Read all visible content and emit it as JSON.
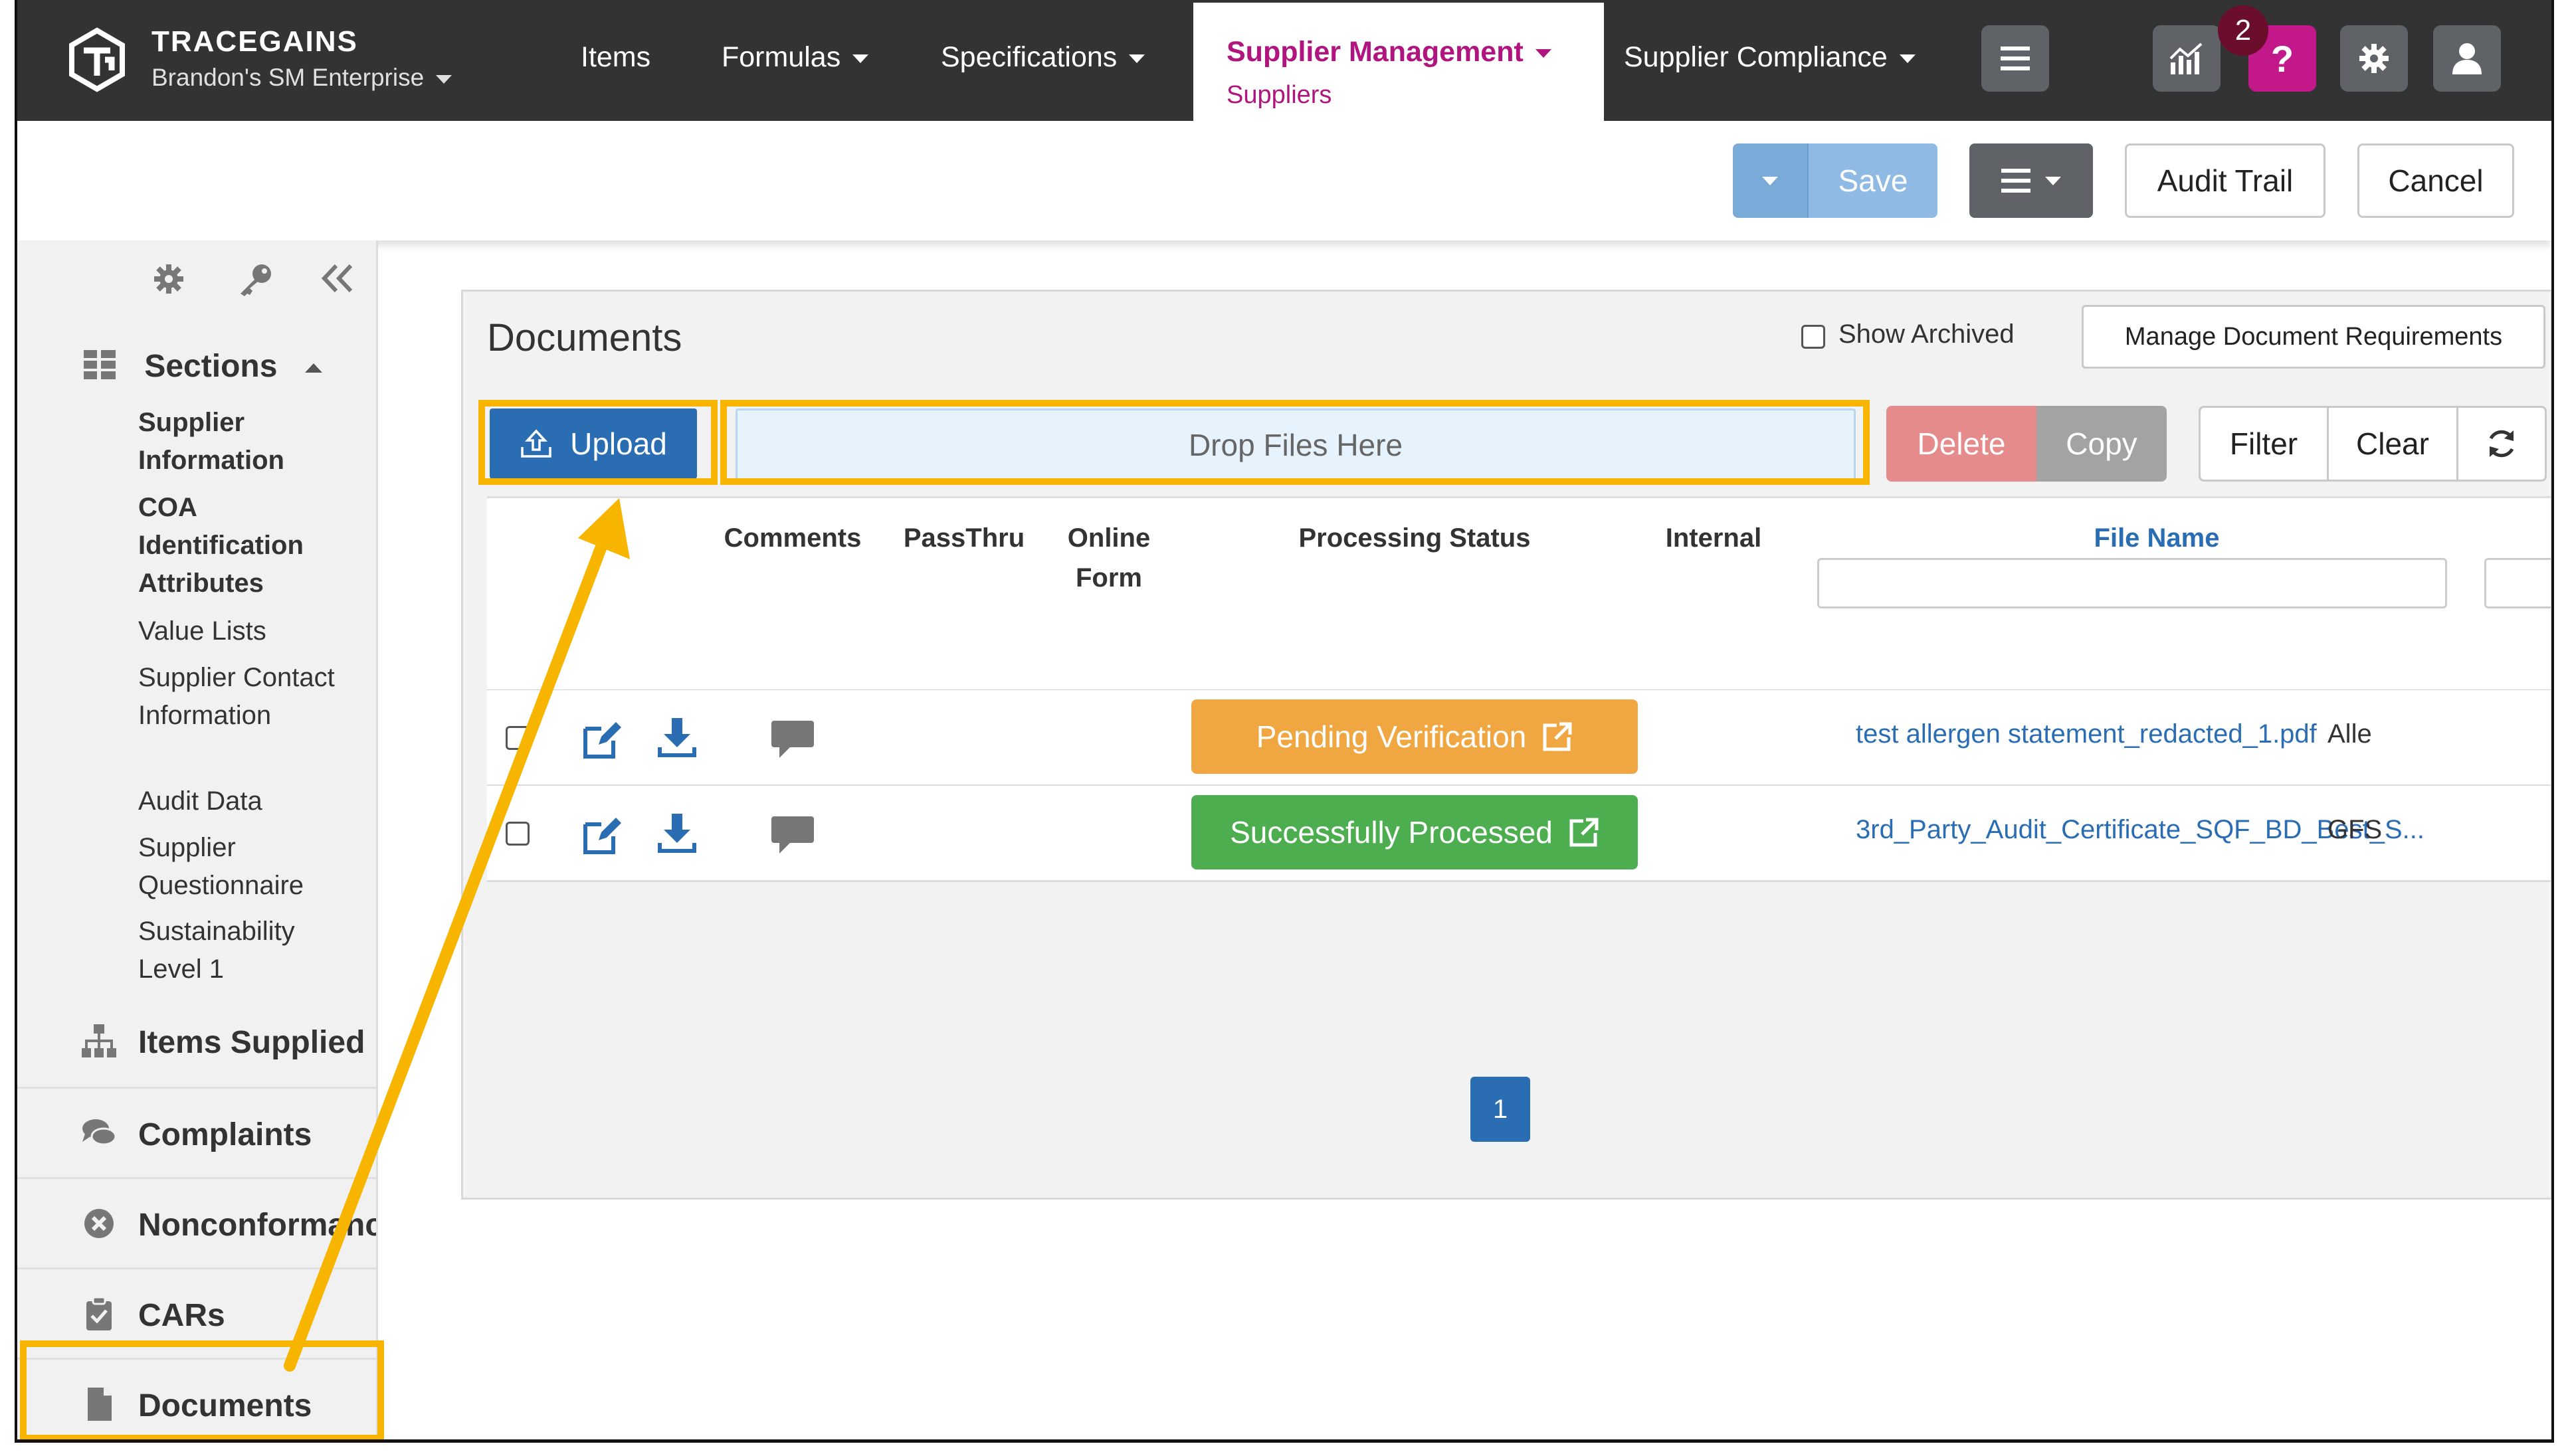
{
  "brand": {
    "name": "TRACEGAINS",
    "org": "Brandon's SM Enterprise"
  },
  "nav": {
    "items": [
      "Items",
      "Formulas",
      "Specifications"
    ],
    "active": {
      "label": "Supplier Management",
      "sub": "Suppliers"
    },
    "compliance": "Supplier Compliance",
    "notification_count": "2",
    "help_label": "?"
  },
  "toolbar": {
    "save": "Save",
    "audit_trail": "Audit Trail",
    "cancel": "Cancel"
  },
  "sidebar": {
    "sections_label": "Sections",
    "subitems": [
      {
        "label": "Supplier Information",
        "bold": true
      },
      {
        "label": "COA Identification Attributes",
        "bold": true
      },
      {
        "label": "Value Lists",
        "bold": false
      },
      {
        "label": "Supplier Contact Information",
        "bold": false
      },
      {
        "label": "Audit Data",
        "bold": false
      },
      {
        "label": "Supplier Questionnaire",
        "bold": false
      },
      {
        "label": "Sustainability Level 1",
        "bold": false
      }
    ],
    "sections": [
      "Items Supplied",
      "Complaints",
      "Nonconformance",
      "CARs",
      "Documents"
    ]
  },
  "documents": {
    "title": "Documents",
    "show_archived": "Show Archived",
    "manage_requirements": "Manage Document Requirements",
    "upload": "Upload",
    "drop_zone": "Drop Files Here",
    "delete": "Delete",
    "copy": "Copy",
    "filter": "Filter",
    "clear": "Clear",
    "columns": {
      "comments": "Comments",
      "passthru": "PassThru",
      "online_form": "Online Form",
      "processing_status": "Processing Status",
      "internal": "Internal",
      "file_name": "File Name"
    },
    "rows": [
      {
        "status": "Pending Verification",
        "status_color": "#f0a742",
        "file": "test allergen statement_redacted_1.pdf",
        "trail": "Alle"
      },
      {
        "status": "Successfully Processed",
        "status_color": "#4cae4f",
        "file": "3rd_Party_Audit_Certificate_SQF_BD_Best_S...",
        "trail": "GFS"
      }
    ],
    "page": "1"
  },
  "colors": {
    "highlight": "#f7b500",
    "nav_bg": "#333333",
    "brand_accent": "#b0157f",
    "link": "#2a6db3"
  }
}
